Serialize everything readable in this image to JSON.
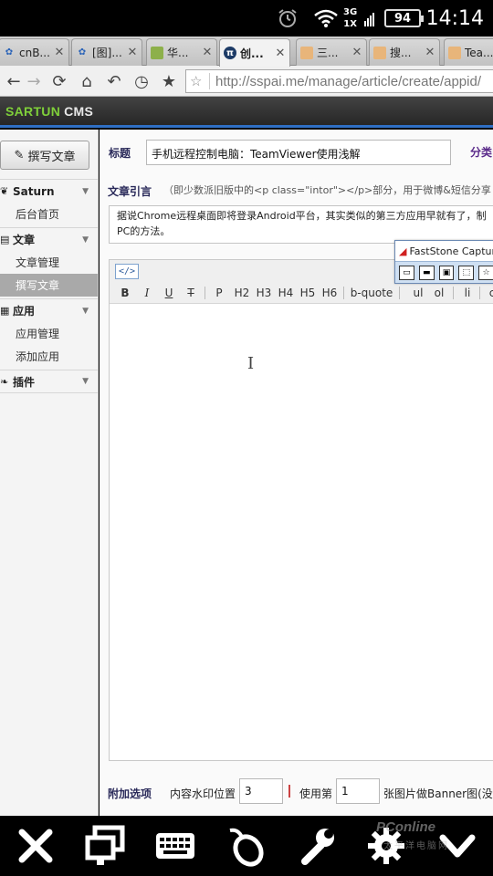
{
  "status_bar": {
    "network_top": "3G",
    "network_bottom": "1X",
    "battery": "94",
    "time": "14:14"
  },
  "browser": {
    "tabs": [
      {
        "label": "cnB...",
        "icon": "paw-icon",
        "active": false
      },
      {
        "label": "[图]...",
        "icon": "paw-icon",
        "active": false
      },
      {
        "label": "华...",
        "icon": "site-icon",
        "active": false
      },
      {
        "label": "创...",
        "icon": "pi-icon",
        "active": true
      },
      {
        "label": "三...",
        "icon": "site-icon",
        "active": false
      },
      {
        "label": "搜...",
        "icon": "site-icon",
        "active": false
      },
      {
        "label": "Tea...",
        "icon": "site-icon",
        "active": false
      }
    ],
    "url": "http://sspai.me/manage/article/create/appid/"
  },
  "cms": {
    "brand": "SARTUN",
    "brand_suffix": "CMS"
  },
  "sidebar": {
    "write_button": "撰写文章",
    "sections": [
      {
        "title": "Saturn",
        "items": [
          "后台首页"
        ]
      },
      {
        "title": "文章",
        "items": [
          "文章管理",
          "撰写文章"
        ]
      },
      {
        "title": "应用",
        "items": [
          "应用管理",
          "添加应用"
        ]
      },
      {
        "title": "插件",
        "items": []
      }
    ],
    "active_item": "撰写文章"
  },
  "form": {
    "title_label": "标题",
    "title_value": "手机远程控制电脑：TeamViewer使用浅解",
    "category_label": "分类",
    "excerpt_label": "文章引言",
    "excerpt_hint": "（即少数派旧版中的<p class=\"intor\"></p>部分，用于微博&短信分享",
    "excerpt_value": "据说Chrome远程桌面即将登录Android平台，其实类似的第三方应用早就有了，制PC的方法。",
    "code_button": "</>",
    "toolbar_buttons": [
      "B",
      "I",
      "U",
      "T",
      "P",
      "H2",
      "H3",
      "H4",
      "H5",
      "H6",
      "b-quote",
      "ul",
      "ol",
      "li",
      "c"
    ],
    "options_label": "附加选项",
    "watermark_label": "内容水印位置",
    "watermark_value": "3",
    "use_label": "使用第",
    "use_value": "1",
    "banner_label": "张图片做Banner图(没有"
  },
  "faststone": {
    "title": "FastStone Capture"
  },
  "bottom_bar": {
    "buttons": [
      "close-icon",
      "monitor-icon",
      "keyboard-icon",
      "mouse-icon",
      "wrench-icon",
      "gear-icon",
      "chevron-down-icon"
    ]
  },
  "watermark": {
    "text": "PConline",
    "sub": "太平洋电脑网"
  }
}
